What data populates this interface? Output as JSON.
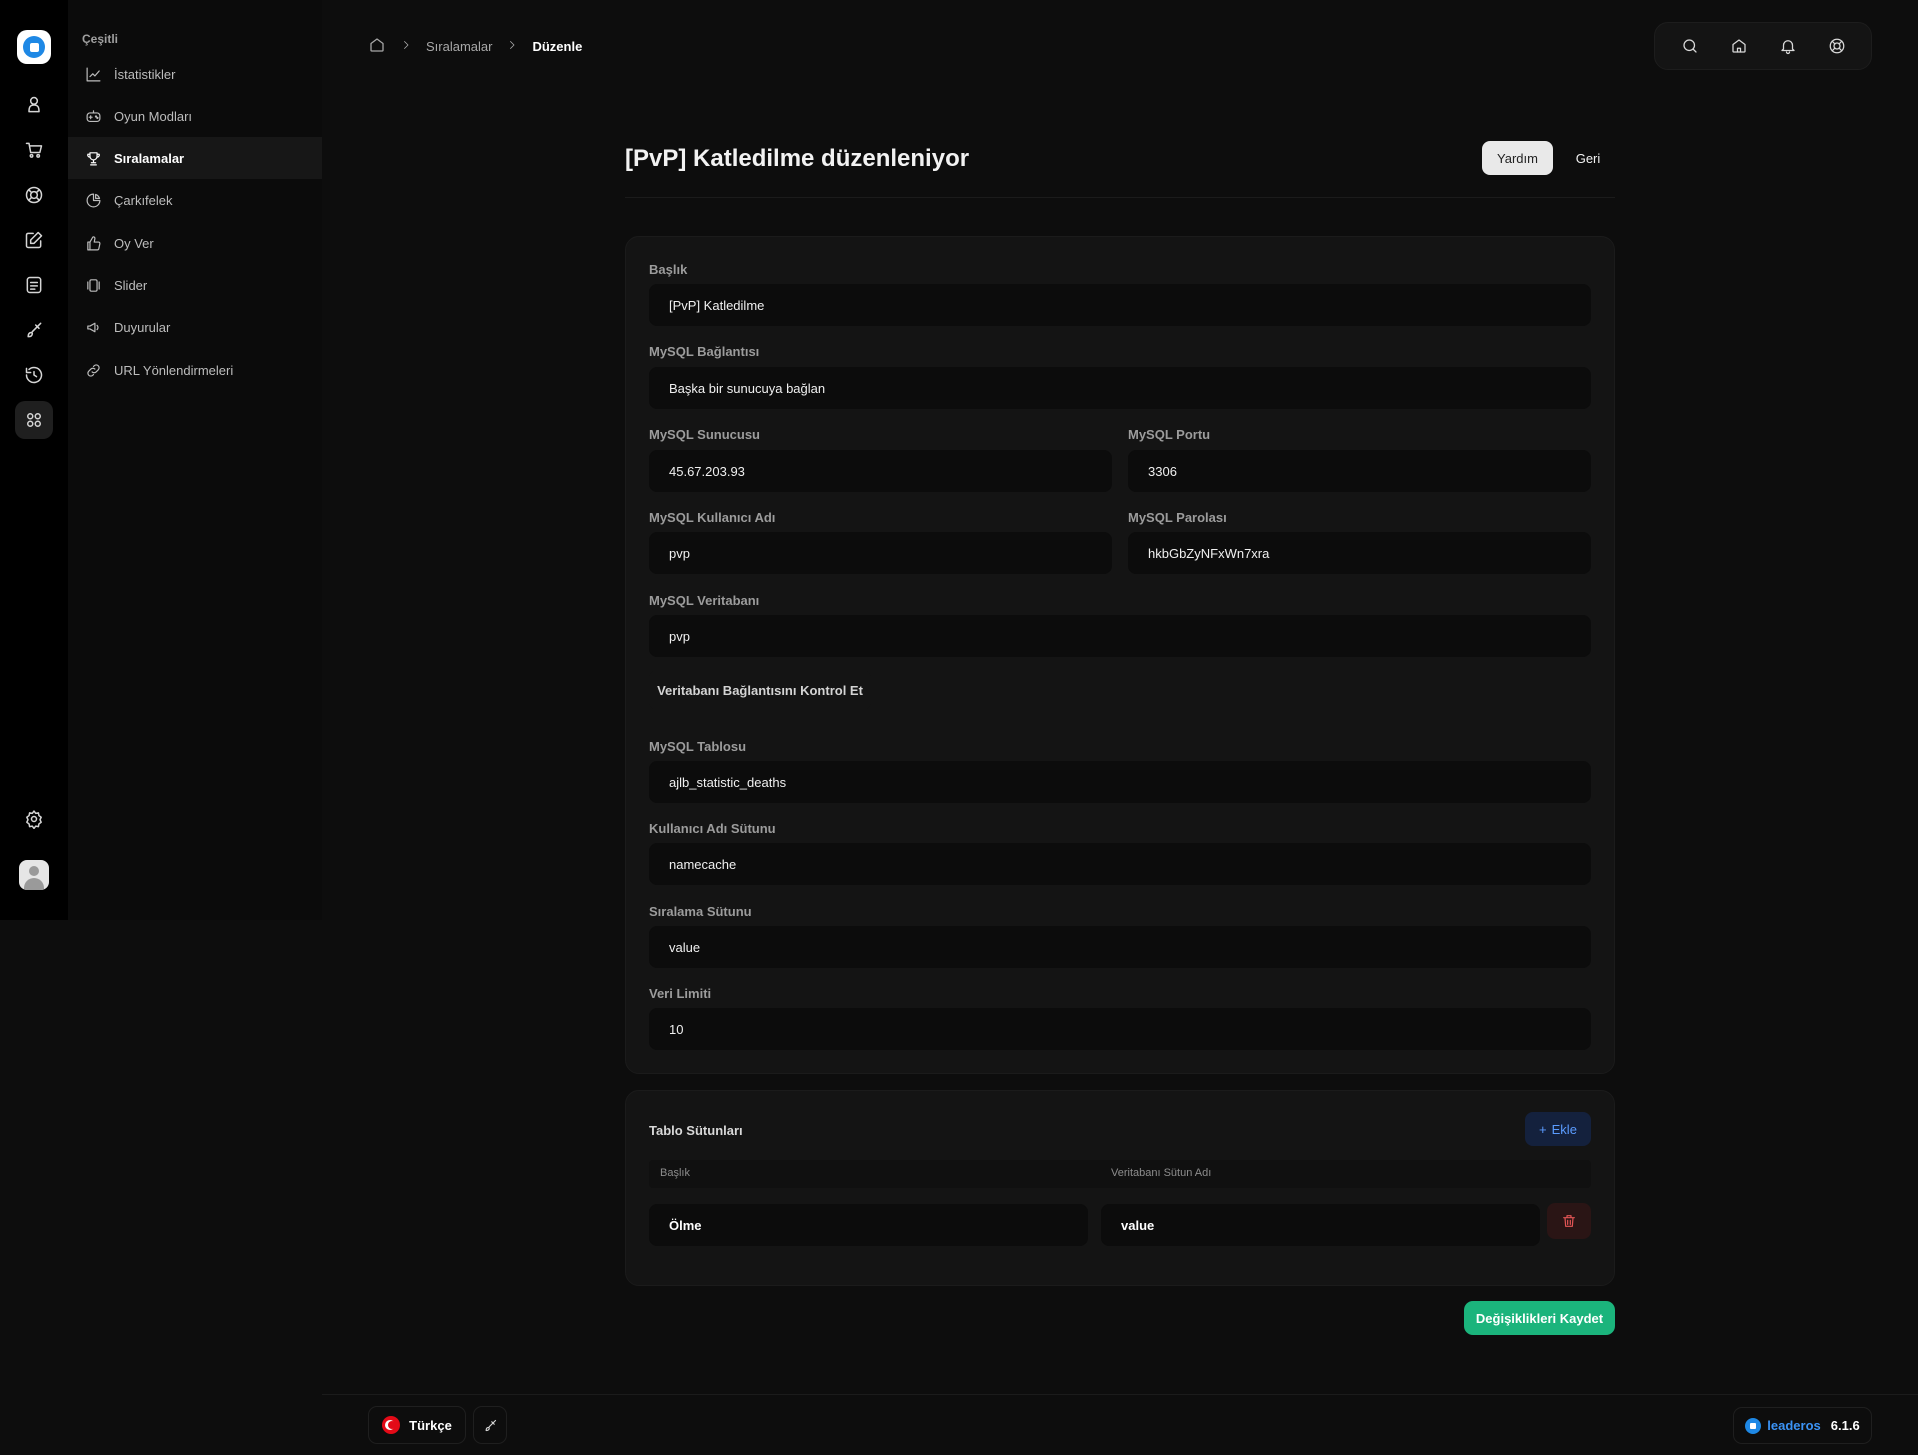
{
  "colors": {
    "accent": "#1e88e5",
    "save": "#1bb47c",
    "add_text": "#5b9cff",
    "danger": "#e25555",
    "background": "#0d0d0d",
    "card": "#141414"
  },
  "rail": {
    "items": [
      {
        "icon": "user-icon"
      },
      {
        "icon": "cart-icon"
      },
      {
        "icon": "lifebuoy-icon"
      },
      {
        "icon": "edit-icon"
      },
      {
        "icon": "document-icon"
      },
      {
        "icon": "brush-icon"
      },
      {
        "icon": "history-icon"
      },
      {
        "icon": "grid-icon",
        "active": true
      }
    ],
    "bottom": [
      {
        "icon": "settings-icon"
      },
      {
        "icon": "avatar-icon"
      }
    ]
  },
  "submenu": {
    "title": "Çeşitli",
    "items": [
      {
        "label": "İstatistikler",
        "icon": "chart-icon"
      },
      {
        "label": "Oyun Modları",
        "icon": "gamepad-icon"
      },
      {
        "label": "Sıralamalar",
        "icon": "trophy-icon",
        "active": true
      },
      {
        "label": "Çarkıfelek",
        "icon": "pie-icon"
      },
      {
        "label": "Oy Ver",
        "icon": "thumbs-up-icon"
      },
      {
        "label": "Slider",
        "icon": "slider-icon"
      },
      {
        "label": "Duyurular",
        "icon": "megaphone-icon"
      },
      {
        "label": "URL Yönlendirmeleri",
        "icon": "link-icon"
      }
    ]
  },
  "breadcrumb": {
    "items": [
      "Sıralamalar"
    ],
    "current": "Düzenle"
  },
  "top_actions": [
    "search-icon",
    "home-icon",
    "bell-icon",
    "support-icon"
  ],
  "page": {
    "title": "[PvP] Katledilme düzenleniyor",
    "help_label": "Yardım",
    "back_label": "Geri"
  },
  "form": {
    "title_label": "Başlık",
    "title_value": "[PvP] Katledilme",
    "connection_label": "MySQL Bağlantısı",
    "connection_value": "Başka bir sunucuya bağlan",
    "host_label": "MySQL Sunucusu",
    "host_value": "45.67.203.93",
    "port_label": "MySQL Portu",
    "port_value": "3306",
    "user_label": "MySQL Kullanıcı Adı",
    "user_value": "pvp",
    "password_label": "MySQL Parolası",
    "password_value": "hkbGbZyNFxWn7xra",
    "database_label": "MySQL Veritabanı",
    "database_value": "pvp",
    "check_button": "Veritabanı Bağlantısını Kontrol Et",
    "table_label": "MySQL Tablosu",
    "table_value": "ajlb_statistic_deaths",
    "username_column_label": "Kullanıcı Adı Sütunu",
    "username_column_value": "namecache",
    "order_column_label": "Sıralama Sütunu",
    "order_column_value": "value",
    "limit_label": "Veri Limiti",
    "limit_value": "10"
  },
  "columns": {
    "title": "Tablo Sütunları",
    "add_label": "Ekle",
    "headers": [
      "Başlık",
      "Veritabanı Sütun Adı"
    ],
    "rows": [
      {
        "title": "Ölme",
        "column": "value"
      }
    ]
  },
  "save_label": "Değişiklikleri Kaydet",
  "footer": {
    "language": "Türkçe",
    "brand": "leaderos",
    "version": "6.1.6"
  }
}
